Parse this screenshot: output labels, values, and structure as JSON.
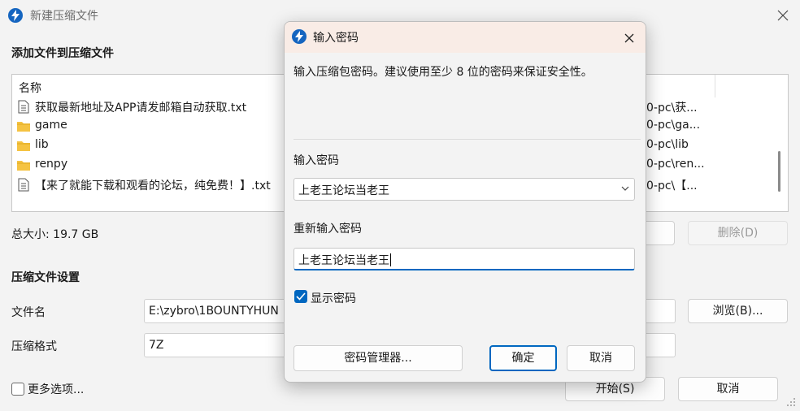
{
  "window": {
    "title": "新建压缩文件",
    "add_files_heading": "添加文件到压缩文件",
    "list_header": "名称",
    "files": [
      {
        "name": "获取最新地址及APP请发邮箱自动获取.txt",
        "path": "0-pc\\获...",
        "icon": "text-file-icon"
      },
      {
        "name": "game",
        "path": "0-pc\\ga...",
        "icon": "folder-icon"
      },
      {
        "name": "lib",
        "path": "0-pc\\lib",
        "icon": "folder-icon"
      },
      {
        "name": "renpy",
        "path": "0-pc\\ren...",
        "icon": "folder-icon"
      },
      {
        "name": "【来了就能下载和观看的论坛，纯免费！】.txt",
        "path": "0-pc\\【...",
        "icon": "text-file-icon"
      }
    ],
    "total_size": "总大小: 19.7 GB",
    "delete_button": "删除(D)",
    "settings_heading": "压缩文件设置",
    "filename_label": "文件名",
    "filename_value": "E:\\zybro\\1BOUNTYHUN",
    "browse_button": "浏览(B)...",
    "format_label": "压缩格式",
    "format_value": "7Z",
    "more_options_label": "更多选项...",
    "start_button": "开始(S)",
    "cancel_button": "取消"
  },
  "dialog": {
    "title": "输入密码",
    "description": "输入压缩包密码。建议使用至少 8 位的密码来保证安全性。",
    "password_label": "输入密码",
    "password_value": "上老王论坛当老王",
    "reenter_label": "重新输入密码",
    "reenter_value": "上老王论坛当老王",
    "show_password_label": "显示密码",
    "show_password_checked": true,
    "manager_button": "密码管理器...",
    "ok_button": "确定",
    "cancel_button": "取消"
  },
  "colors": {
    "accent": "#0067c0",
    "app_icon": "#1565c0",
    "folder": "#f5c342",
    "dialog_titlebar": "#f9ece6"
  }
}
